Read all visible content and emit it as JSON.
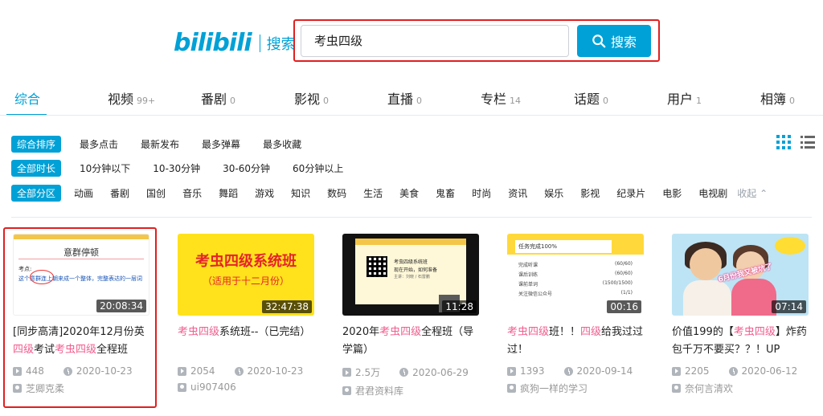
{
  "header": {
    "logo_text": "bilibili",
    "logo_sub": "搜索",
    "search_value": "考虫四级",
    "search_button": "搜索"
  },
  "tabs": [
    {
      "label": "综合",
      "count": ""
    },
    {
      "label": "视频",
      "count": "99+"
    },
    {
      "label": "番剧",
      "count": "0"
    },
    {
      "label": "影视",
      "count": "0"
    },
    {
      "label": "直播",
      "count": "0"
    },
    {
      "label": "专栏",
      "count": "14"
    },
    {
      "label": "话题",
      "count": "0"
    },
    {
      "label": "用户",
      "count": "1"
    },
    {
      "label": "相簿",
      "count": "0"
    }
  ],
  "filters": {
    "order": [
      "综合排序",
      "最多点击",
      "最新发布",
      "最多弹幕",
      "最多收藏"
    ],
    "duration": [
      "全部时长",
      "10分钟以下",
      "10-30分钟",
      "30-60分钟",
      "60分钟以上"
    ],
    "zone": [
      "全部分区",
      "动画",
      "番剧",
      "国创",
      "音乐",
      "舞蹈",
      "游戏",
      "知识",
      "数码",
      "生活",
      "美食",
      "鬼畜",
      "时尚",
      "资讯",
      "娱乐",
      "影视",
      "纪录片",
      "电影",
      "电视剧"
    ],
    "collapse": "收起"
  },
  "videos": [
    {
      "duration": "20:08:34",
      "title_parts": [
        "[同步高清]2020年12月份英",
        "四级",
        "考试",
        "考虫四级",
        "全程班"
      ],
      "views": "448",
      "date": "2020-10-23",
      "author": "芝卿克柔",
      "thumb": {
        "title": "意群停顿",
        "line2": "考点:",
        "line3": "这个意群连上朝来成一个整体，完整表达的一层词"
      }
    },
    {
      "duration": "32:47:38",
      "title_parts": [
        "考虫四级",
        "系统班--（已完结）"
      ],
      "views": "2054",
      "date": "2020-10-23",
      "author": "ui907406",
      "thumb": {
        "big": "考虫四级系统班",
        "small": "（适用于十二月份）"
      }
    },
    {
      "duration": "11:28",
      "title_parts": [
        "2020年",
        "考虫四级",
        "全程班（导学篇）"
      ],
      "views": "2.5万",
      "date": "2020-06-29",
      "author": "君君资料库",
      "thumb": {
        "s1": "考虫四级系统班",
        "s2": "现在开始，如何准备",
        "s3": "主讲：刘晓 / 石雷鹏"
      }
    },
    {
      "duration": "00:16",
      "title_parts": [
        "考虫四级",
        "班！！",
        "四级",
        "给我过过过！"
      ],
      "views": "1393",
      "date": "2020-09-14",
      "author": "疯狗一样的学习",
      "thumb": {
        "header": "任务完成100%",
        "rows": [
          [
            "完成听课",
            "(60/60)"
          ],
          [
            "课后训练",
            "(60/60)"
          ],
          [
            "课前单词",
            "(1500/1500)"
          ],
          [
            "关注微信公众号",
            "(1/1)"
          ]
        ]
      }
    },
    {
      "duration": "07:14",
      "title_parts": [
        "价值199的【",
        "考虫四级",
        "】炸药包千万不要买？？！UP"
      ],
      "views": "2205",
      "date": "2020-06-12",
      "author": "奈何言清欢",
      "thumb": {
        "caption": "6月份我又被坑了"
      }
    }
  ],
  "colors": {
    "accent": "#00a1d6",
    "highlight": "#f25d8e",
    "annotation": "#e02020"
  }
}
